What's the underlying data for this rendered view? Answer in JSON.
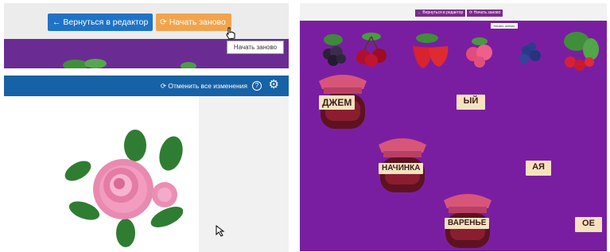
{
  "editor_preview": {
    "back_label": "Вернуться в редактор",
    "restart_label": "Начать заново",
    "tooltip": "Начать заново"
  },
  "editor": {
    "undo_all_label": "Отменить все изменения",
    "help_icon": "question-circle-icon",
    "settings_icon": "gear-icon",
    "help_glyph": "?",
    "settings_glyph": "⚙",
    "back_arrow_glyph": "←",
    "restart_glyph": "⟳"
  },
  "game": {
    "back_label": "Вернуться в редактор",
    "restart_label": "Начать заново",
    "tooltip": "Начать заново",
    "jars": [
      {
        "label": "ДЖЕМ"
      },
      {
        "label": "НАЧИНКА"
      },
      {
        "label": "ВАРЕНЬЕ"
      }
    ],
    "endings": [
      "ЫЙ",
      "АЯ",
      "ОЕ"
    ],
    "berries": [
      "blackberry",
      "cherry",
      "strawberry",
      "raspberry",
      "blueberry",
      "wild-strawberry"
    ]
  },
  "colors": {
    "purple": "#7a1ea1",
    "blue_button": "#1f73c6",
    "orange_button": "#f2a44c",
    "toolbar_blue": "#1762a6",
    "card": "#f7e2c0"
  }
}
